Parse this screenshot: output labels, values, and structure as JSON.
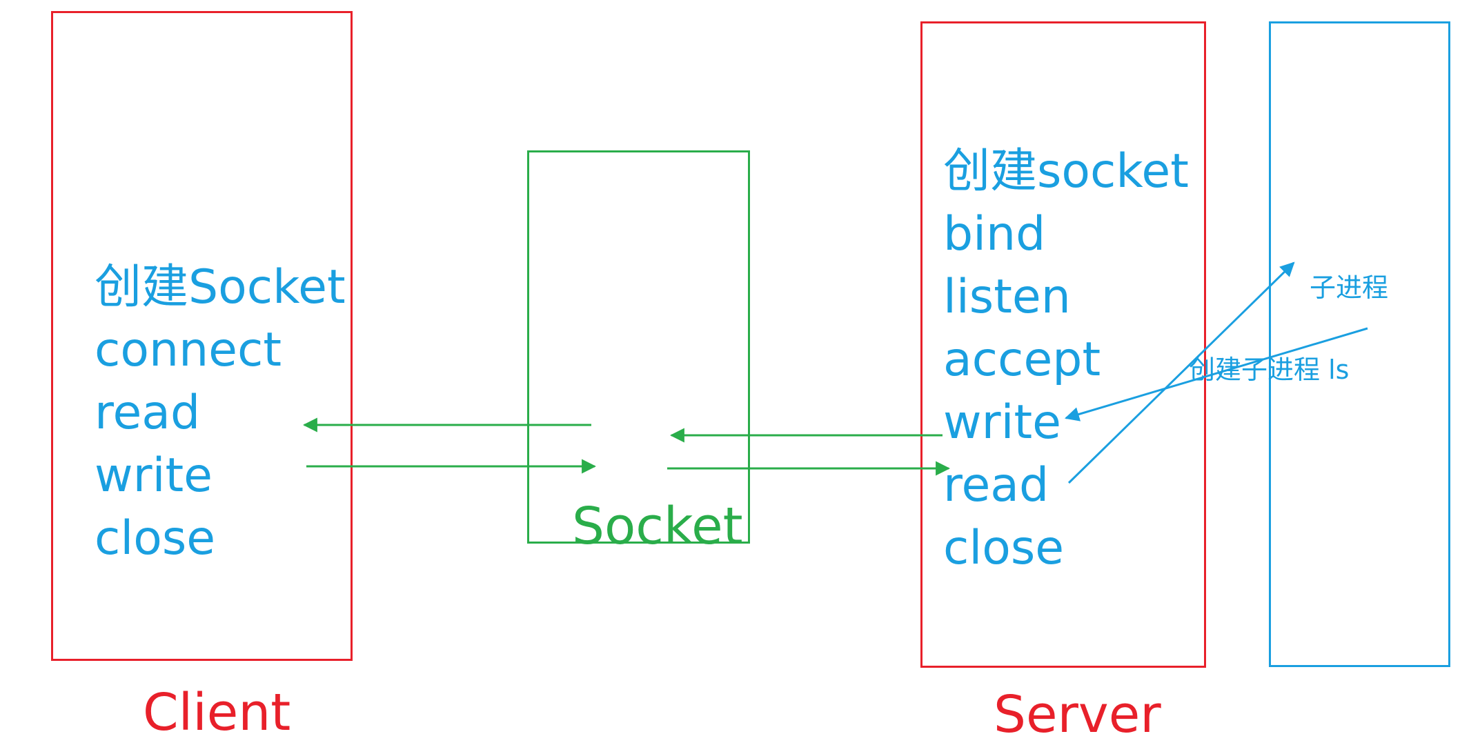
{
  "colors": {
    "client": "#e8202a",
    "socket": "#2aad4a",
    "server": "#e8202a",
    "child_process": "#1a9fe0",
    "step_text": "#1a9fe0"
  },
  "client": {
    "caption": "Client",
    "steps": [
      "创建Socket",
      "connect",
      "read",
      "write",
      "close"
    ]
  },
  "socket": {
    "caption": "Socket"
  },
  "server": {
    "caption": "Server",
    "steps": [
      "创建socket",
      "bind",
      "listen",
      "accept",
      "write",
      "read",
      "close"
    ]
  },
  "child_process": {
    "label": "子进程",
    "create_note": "创建子进程 ls"
  }
}
